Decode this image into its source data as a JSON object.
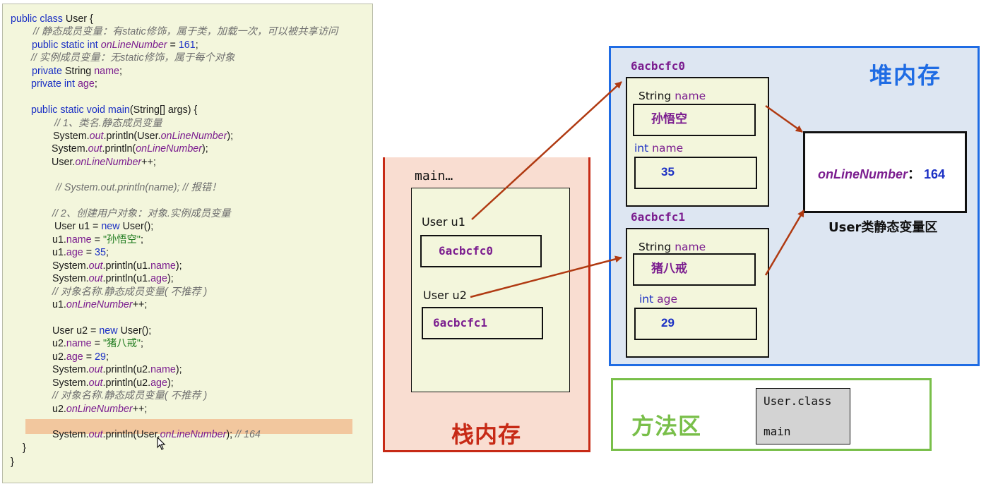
{
  "code": {
    "lines": [
      [
        {
          "t": "public class ",
          "c": "kw"
        },
        {
          "t": "User {",
          "c": ""
        }
      ],
      [
        {
          "t": "// 静态成员变量：有static修饰，属于类，加载一次，可以被共享访问",
          "c": "cmt"
        }
      ],
      [
        {
          "t": "public static int ",
          "c": "kw"
        },
        {
          "t": "onLineNumber",
          "c": "sfld"
        },
        {
          "t": " = ",
          "c": ""
        },
        {
          "t": "161",
          "c": "num"
        },
        {
          "t": ";",
          "c": ""
        }
      ],
      [
        {
          "t": "// 实例成员变量：无static修饰，属于每个对象",
          "c": "cmt"
        }
      ],
      [
        {
          "t": "private ",
          "c": "kw"
        },
        {
          "t": "String ",
          "c": ""
        },
        {
          "t": "name",
          "c": "fld"
        },
        {
          "t": ";",
          "c": ""
        }
      ],
      [
        {
          "t": "private int ",
          "c": "kw"
        },
        {
          "t": "age",
          "c": "fld"
        },
        {
          "t": ";",
          "c": ""
        }
      ],
      [],
      [
        {
          "t": "public static void ",
          "c": "kw"
        },
        {
          "t": "main",
          "c": "kw"
        },
        {
          "t": "(String[] args) {",
          "c": ""
        }
      ],
      [
        {
          "t": "// 1、类名.静态成员变量",
          "c": "cmt"
        }
      ],
      [
        {
          "t": "System.",
          "c": ""
        },
        {
          "t": "out",
          "c": "out"
        },
        {
          "t": ".println(User.",
          "c": ""
        },
        {
          "t": "onLineNumber",
          "c": "sfld"
        },
        {
          "t": ");",
          "c": ""
        }
      ],
      [
        {
          "t": "System.",
          "c": ""
        },
        {
          "t": "out",
          "c": "out"
        },
        {
          "t": ".println(",
          "c": ""
        },
        {
          "t": "onLineNumber",
          "c": "sfld"
        },
        {
          "t": ");",
          "c": ""
        }
      ],
      [
        {
          "t": "User.",
          "c": ""
        },
        {
          "t": "onLineNumber",
          "c": "sfld"
        },
        {
          "t": "++;",
          "c": ""
        }
      ],
      [],
      [
        {
          "t": "// System.out.println(name); // 报错！",
          "c": "cmt"
        }
      ],
      [],
      [
        {
          "t": "// 2、创建用户对象：对象.实例成员变量",
          "c": "cmt"
        }
      ],
      [
        {
          "t": "User u1 = ",
          "c": ""
        },
        {
          "t": "new ",
          "c": "kw"
        },
        {
          "t": "User();",
          "c": ""
        }
      ],
      [
        {
          "t": "u1.",
          "c": ""
        },
        {
          "t": "name",
          "c": "fld"
        },
        {
          "t": " = ",
          "c": ""
        },
        {
          "t": "\"孙悟空\"",
          "c": "str"
        },
        {
          "t": ";",
          "c": ""
        }
      ],
      [
        {
          "t": "u1.",
          "c": ""
        },
        {
          "t": "age",
          "c": "fld"
        },
        {
          "t": " = ",
          "c": ""
        },
        {
          "t": "35",
          "c": "num"
        },
        {
          "t": ";",
          "c": ""
        }
      ],
      [
        {
          "t": "System.",
          "c": ""
        },
        {
          "t": "out",
          "c": "out"
        },
        {
          "t": ".println(u1.",
          "c": ""
        },
        {
          "t": "name",
          "c": "fld"
        },
        {
          "t": ");",
          "c": ""
        }
      ],
      [
        {
          "t": "System.",
          "c": ""
        },
        {
          "t": "out",
          "c": "out"
        },
        {
          "t": ".println(u1.",
          "c": ""
        },
        {
          "t": "age",
          "c": "fld"
        },
        {
          "t": ");",
          "c": ""
        }
      ],
      [
        {
          "t": "// 对象名称.静态成员变量( 不推荐 )",
          "c": "cmt"
        }
      ],
      [
        {
          "t": "u1.",
          "c": ""
        },
        {
          "t": "onLineNumber",
          "c": "sfld"
        },
        {
          "t": "++;",
          "c": ""
        }
      ],
      [],
      [
        {
          "t": "User u2 = ",
          "c": ""
        },
        {
          "t": "new ",
          "c": "kw"
        },
        {
          "t": "User();",
          "c": ""
        }
      ],
      [
        {
          "t": "u2.",
          "c": ""
        },
        {
          "t": "name",
          "c": "fld"
        },
        {
          "t": " = ",
          "c": ""
        },
        {
          "t": "\"猪八戒\"",
          "c": "str"
        },
        {
          "t": ";",
          "c": ""
        }
      ],
      [
        {
          "t": "u2.",
          "c": ""
        },
        {
          "t": "age",
          "c": "fld"
        },
        {
          "t": " = ",
          "c": ""
        },
        {
          "t": "29",
          "c": "num"
        },
        {
          "t": ";",
          "c": ""
        }
      ],
      [
        {
          "t": "System.",
          "c": ""
        },
        {
          "t": "out",
          "c": "out"
        },
        {
          "t": ".println(u2.",
          "c": ""
        },
        {
          "t": "name",
          "c": "fld"
        },
        {
          "t": ");",
          "c": ""
        }
      ],
      [
        {
          "t": "System.",
          "c": ""
        },
        {
          "t": "out",
          "c": "out"
        },
        {
          "t": ".println(u2.",
          "c": ""
        },
        {
          "t": "age",
          "c": "fld"
        },
        {
          "t": ");",
          "c": ""
        }
      ],
      [
        {
          "t": "// 对象名称.静态成员变量( 不推荐 )",
          "c": "cmt"
        }
      ],
      [
        {
          "t": "u2.",
          "c": ""
        },
        {
          "t": "onLineNumber",
          "c": "sfld"
        },
        {
          "t": "++;",
          "c": ""
        }
      ],
      [],
      [
        {
          "t": "System.",
          "c": ""
        },
        {
          "t": "out",
          "c": "out"
        },
        {
          "t": ".println(User.",
          "c": ""
        },
        {
          "t": "onLineNumber",
          "c": "sfld"
        },
        {
          "t": "); ",
          "c": ""
        },
        {
          "t": "// 164",
          "c": "cmt"
        }
      ],
      [
        {
          "t": "}",
          "c": ""
        }
      ],
      [
        {
          "t": "}",
          "c": ""
        }
      ]
    ]
  },
  "stack": {
    "title": "栈内存",
    "frame_label": "main…",
    "var1_label": "User  u1",
    "var1_value": "6acbcfc0",
    "var2_label": "User u2",
    "var2_value": "6acbcfc1"
  },
  "heap": {
    "title": "堆内存",
    "obj1": {
      "address": "6acbcfc0",
      "field1_type": "String",
      "field1_name": "name",
      "field1_value": "孙悟空",
      "field2_type": "int",
      "field2_name": "name",
      "field2_value": "35"
    },
    "obj2": {
      "address": "6acbcfc1",
      "field1_type": "String",
      "field1_name": "name",
      "field1_value": "猪八戒",
      "field2_type": "int",
      "field2_name": "age",
      "field2_value": "29"
    },
    "static_area": {
      "var_name": "onLineNumber",
      "separator": "：",
      "var_value": "164",
      "caption": "User类静态变量区"
    }
  },
  "method_area": {
    "title": "方法区",
    "entries": [
      "User.class",
      "main"
    ]
  },
  "colors": {
    "stack": "#c72a16",
    "heap": "#1f6ce4",
    "method_area": "#79bf4a",
    "arrow": "#b03a12"
  }
}
